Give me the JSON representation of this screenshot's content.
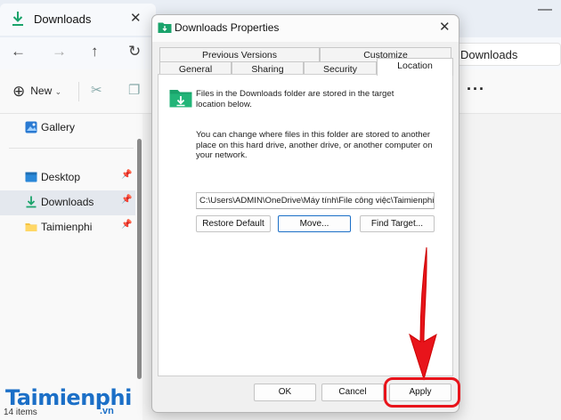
{
  "explorer": {
    "tab_title": "Downloads",
    "address_text": "Downloads",
    "new_label": "New",
    "sidebar": {
      "gallery": "Gallery",
      "items": [
        {
          "label": "Desktop"
        },
        {
          "label": "Downloads"
        },
        {
          "label": "Taimienphi"
        }
      ]
    },
    "status": "14 items"
  },
  "dialog": {
    "title": "Downloads Properties",
    "tabs_row1": [
      "Previous Versions",
      "Customize"
    ],
    "tabs_row2": [
      "General",
      "Sharing",
      "Security",
      "Location"
    ],
    "active_tab": "Location",
    "info_text": "Files in the Downloads folder are stored in the target location below.",
    "change_text": "You can change where files in this folder are stored to another place on this hard drive, another drive, or another computer on your network.",
    "path": "C:\\Users\\ADMIN\\OneDrive\\Máy tính\\File công việc\\Taimienphi",
    "buttons": {
      "restore": "Restore Default",
      "move": "Move...",
      "find": "Find Target..."
    },
    "footer": {
      "ok": "OK",
      "cancel": "Cancel",
      "apply": "Apply"
    }
  },
  "watermark": {
    "brand": "Taimienphi",
    "suffix": ".vn"
  },
  "colors": {
    "accent": "#1b6fc7",
    "highlight": "#e8141b",
    "folder": "#1aa36b"
  }
}
